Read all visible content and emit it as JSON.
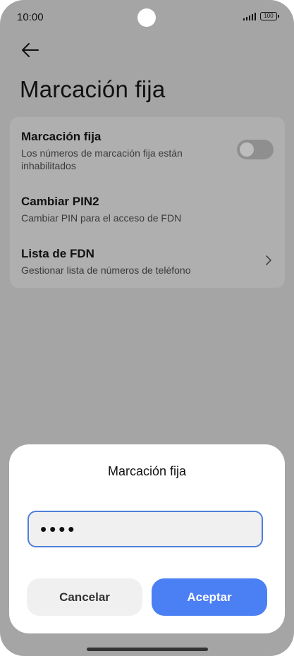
{
  "status_bar": {
    "time": "10:00",
    "battery": "100"
  },
  "header": {
    "title": "Marcación fija"
  },
  "settings": {
    "items": [
      {
        "title": "Marcación fija",
        "subtitle": "Los números de marcación fija están inhabilitados",
        "control": "toggle-off"
      },
      {
        "title": "Cambiar PIN2",
        "subtitle": "Cambiar PIN para el acceso de FDN"
      },
      {
        "title": "Lista de FDN",
        "subtitle": "Gestionar lista de números de teléfono",
        "control": "chevron-right-icon"
      }
    ]
  },
  "dialog": {
    "title": "Marcación fija",
    "pin_value": "••••",
    "cancel_label": "Cancelar",
    "accept_label": "Aceptar"
  },
  "colors": {
    "accent": "#4b7ff4",
    "input_border": "#4f7fd9",
    "dim_background": "#a5a5a5"
  }
}
